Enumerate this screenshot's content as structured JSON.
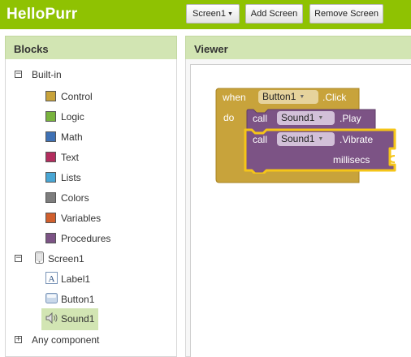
{
  "app": {
    "title": "HelloPurr"
  },
  "toolbar": {
    "screen_select": "Screen1",
    "add_screen": "Add Screen",
    "remove_screen": "Remove Screen"
  },
  "blocks_panel": {
    "title": "Blocks",
    "builtin": {
      "label": "Built-in",
      "toggle": "−",
      "items": [
        {
          "label": "Control",
          "color": "#c8a33b"
        },
        {
          "label": "Logic",
          "color": "#79b33e"
        },
        {
          "label": "Math",
          "color": "#3f71b5"
        },
        {
          "label": "Text",
          "color": "#b32d5e"
        },
        {
          "label": "Lists",
          "color": "#49a6d4"
        },
        {
          "label": "Colors",
          "color": "#7d7d7d"
        },
        {
          "label": "Variables",
          "color": "#d05f2d"
        },
        {
          "label": "Procedures",
          "color": "#7c5385"
        }
      ]
    },
    "screen": {
      "label": "Screen1",
      "toggle": "−",
      "components": [
        {
          "label": "Label1",
          "icon": "label-icon"
        },
        {
          "label": "Button1",
          "icon": "button-icon"
        },
        {
          "label": "Sound1",
          "icon": "sound-icon",
          "selected": true
        }
      ]
    },
    "any_component": {
      "label": "Any component",
      "toggle": "+"
    }
  },
  "viewer": {
    "title": "Viewer",
    "event_block": {
      "when": "when",
      "component": "Button1",
      "event": ".Click",
      "do": "do",
      "color": "#c8a33b"
    },
    "call_play": {
      "call": "call",
      "component": "Sound1",
      "method": ".Play",
      "color": "#7c5385"
    },
    "call_vibrate": {
      "call": "call",
      "component": "Sound1",
      "method": ".Vibrate",
      "param": "millisecs",
      "color": "#7c5385",
      "highlight": "#f5c518"
    }
  }
}
